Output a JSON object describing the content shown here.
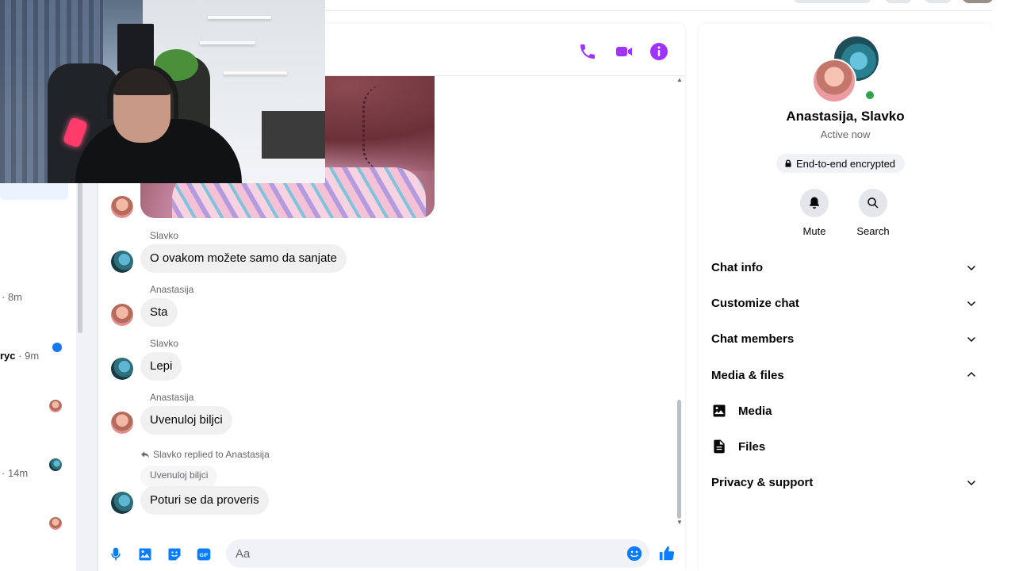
{
  "left_list": {
    "items": [
      {
        "time": "· 8m"
      },
      {
        "prefix": "ryc",
        "time": " · 9m"
      },
      {
        "time": "· 14m"
      }
    ]
  },
  "chat": {
    "messages": [
      {
        "sender": "Slavko",
        "text": "O ovakom možete samo da sanjate"
      },
      {
        "sender": "Anastasija",
        "text": "Sta"
      },
      {
        "sender": "Slavko",
        "text": "Lepi"
      },
      {
        "sender": "Anastasija",
        "text": "Uvenuloj biljci"
      }
    ],
    "reply": {
      "note": "Slavko replied to Anastasija",
      "quoted": "Uvenuloj biljci",
      "text": "Poturi se da proveris"
    },
    "composer": {
      "placeholder": "Aa"
    }
  },
  "right_panel": {
    "title": "Anastasija, Slavko",
    "status": "Active now",
    "encryption": "End-to-end encrypted",
    "actions": [
      {
        "label": "Mute",
        "icon": "bell-icon"
      },
      {
        "label": "Search",
        "icon": "search-icon"
      }
    ],
    "sections": {
      "chat_info": "Chat info",
      "customize_chat": "Customize chat",
      "chat_members": "Chat members",
      "media_files": "Media & files",
      "media": "Media",
      "files": "Files",
      "privacy_support": "Privacy & support"
    }
  },
  "colors": {
    "accent": "#a033ff",
    "messenger_blue": "#0a7cff",
    "online": "#31a24c",
    "bubble": "#f0f0f0"
  }
}
